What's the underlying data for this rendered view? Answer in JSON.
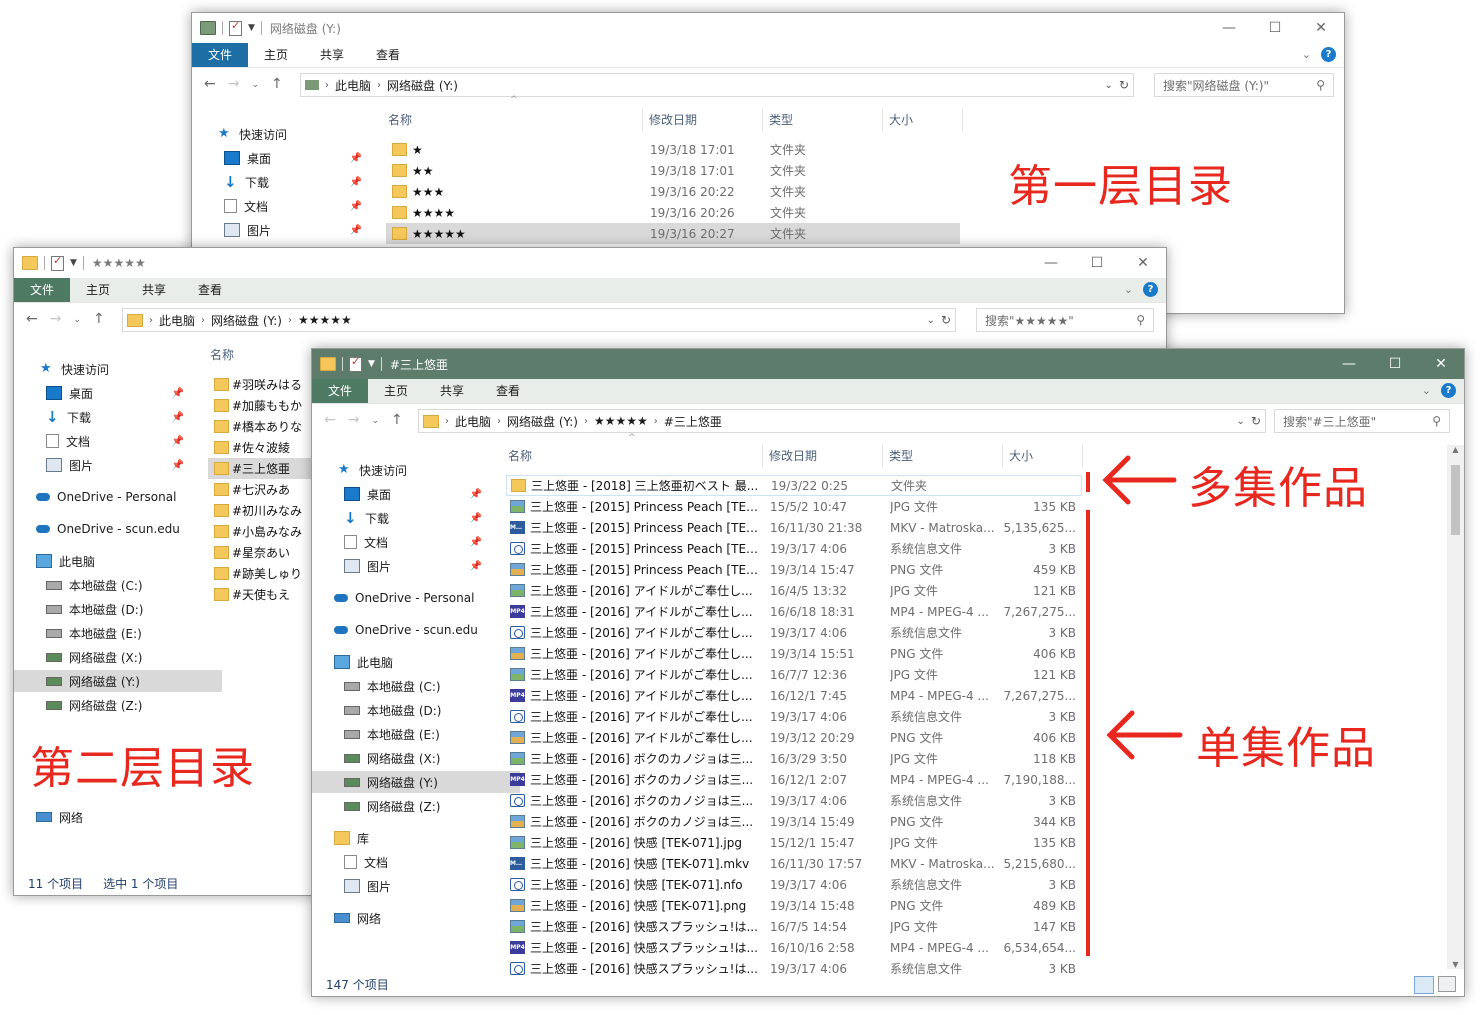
{
  "win1": {
    "title": "网络磁盘 (Y:)",
    "tabs": [
      "文件",
      "主页",
      "共享",
      "查看"
    ],
    "breadcrumbs": [
      "此电脑",
      "网络磁盘 (Y:)"
    ],
    "search_placeholder": "搜索\"网络磁盘 (Y:)\"",
    "sidebar": [
      {
        "icon": "star-icon",
        "label": "快速访问"
      },
      {
        "icon": "desktop-icon",
        "label": "桌面",
        "pinned": true
      },
      {
        "icon": "download-icon",
        "label": "下载",
        "pinned": true
      },
      {
        "icon": "document-icon",
        "label": "文档",
        "pinned": true
      },
      {
        "icon": "pictures-icon",
        "label": "图片",
        "pinned": true
      }
    ],
    "columns": {
      "name": "名称",
      "date": "修改日期",
      "type": "类型",
      "size": "大小"
    },
    "rows": [
      {
        "name": "★",
        "date": "19/3/18 17:01",
        "type": "文件夹"
      },
      {
        "name": "★★",
        "date": "19/3/18 17:01",
        "type": "文件夹"
      },
      {
        "name": "★★★",
        "date": "19/3/16 20:22",
        "type": "文件夹"
      },
      {
        "name": "★★★★",
        "date": "19/3/16 20:26",
        "type": "文件夹"
      },
      {
        "name": "★★★★★",
        "date": "19/3/16 20:27",
        "type": "文件夹",
        "selected": true
      }
    ]
  },
  "win2": {
    "title": "★★★★★",
    "tabs": [
      "文件",
      "主页",
      "共享",
      "查看"
    ],
    "breadcrumbs": [
      "此电脑",
      "网络磁盘 (Y:)",
      "★★★★★"
    ],
    "search_placeholder": "搜索\"★★★★★\"",
    "sidebar": [
      {
        "icon": "star-icon",
        "label": "快速访问"
      },
      {
        "icon": "desktop-icon",
        "label": "桌面",
        "pinned": true
      },
      {
        "icon": "download-icon",
        "label": "下载",
        "pinned": true
      },
      {
        "icon": "document-icon",
        "label": "文档",
        "pinned": true
      },
      {
        "icon": "pictures-icon",
        "label": "图片",
        "pinned": true
      },
      {
        "icon": "onedrive-icon",
        "label": "OneDrive - Personal"
      },
      {
        "icon": "onedrive-icon",
        "label": "OneDrive - scun.edu"
      },
      {
        "icon": "this-pc-icon",
        "label": "此电脑"
      },
      {
        "icon": "drive-icon",
        "label": "本地磁盘 (C:)"
      },
      {
        "icon": "drive-icon",
        "label": "本地磁盘 (D:)"
      },
      {
        "icon": "drive-icon",
        "label": "本地磁盘 (E:)"
      },
      {
        "icon": "network-drive-icon",
        "label": "网络磁盘 (X:)"
      },
      {
        "icon": "network-drive-icon",
        "label": "网络磁盘 (Y:)",
        "selected": true
      },
      {
        "icon": "network-drive-icon",
        "label": "网络磁盘 (Z:)"
      },
      {
        "icon": "network-icon",
        "label": "网络"
      }
    ],
    "name_header": "名称",
    "folders": [
      "#羽咲みはる",
      "#加藤ももか",
      "#橋本ありな",
      "#佐々波綾",
      "#三上悠亜",
      "#七沢みあ",
      "#初川みなみ",
      "#小島みなみ",
      "#星奈あい",
      "#跡美しゅり",
      "#天使もえ"
    ],
    "status": {
      "count": "11 个项目",
      "selected": "选中 1 个项目"
    }
  },
  "win3": {
    "title": "#三上悠亜",
    "tabs": [
      "文件",
      "主页",
      "共享",
      "查看"
    ],
    "breadcrumbs": [
      "此电脑",
      "网络磁盘 (Y:)",
      "★★★★★",
      "#三上悠亜"
    ],
    "search_placeholder": "搜索\"#三上悠亜\"",
    "sidebar": [
      {
        "icon": "star-icon",
        "label": "快速访问"
      },
      {
        "icon": "desktop-icon",
        "label": "桌面",
        "pinned": true
      },
      {
        "icon": "download-icon",
        "label": "下载",
        "pinned": true
      },
      {
        "icon": "document-icon",
        "label": "文档",
        "pinned": true
      },
      {
        "icon": "pictures-icon",
        "label": "图片",
        "pinned": true
      },
      {
        "icon": "onedrive-icon",
        "label": "OneDrive - Personal"
      },
      {
        "icon": "onedrive-icon",
        "label": "OneDrive - scun.edu"
      },
      {
        "icon": "this-pc-icon",
        "label": "此电脑"
      },
      {
        "icon": "drive-icon",
        "label": "本地磁盘 (C:)"
      },
      {
        "icon": "drive-icon",
        "label": "本地磁盘 (D:)"
      },
      {
        "icon": "drive-icon",
        "label": "本地磁盘 (E:)"
      },
      {
        "icon": "network-drive-icon",
        "label": "网络磁盘 (X:)"
      },
      {
        "icon": "network-drive-icon",
        "label": "网络磁盘 (Y:)",
        "selected": true
      },
      {
        "icon": "network-drive-icon",
        "label": "网络磁盘 (Z:)"
      },
      {
        "icon": "library-icon",
        "label": "库"
      },
      {
        "icon": "document-icon",
        "label": "文档"
      },
      {
        "icon": "pictures-icon",
        "label": "图片"
      },
      {
        "icon": "network-icon",
        "label": "网络"
      }
    ],
    "columns": {
      "name": "名称",
      "date": "修改日期",
      "type": "类型",
      "size": "大小"
    },
    "rows": [
      {
        "kind": "folder",
        "name": "三上悠亜 - [2018] 三上悠亜初ベスト 最...",
        "date": "19/3/22 0:25",
        "type": "文件夹",
        "size": ""
      },
      {
        "kind": "jpg",
        "name": "三上悠亜 - [2015] Princess Peach [TEK...",
        "date": "15/5/2 10:47",
        "type": "JPG 文件",
        "size": "135 KB"
      },
      {
        "kind": "mkv",
        "name": "三上悠亜 - [2015] Princess Peach [TEK...",
        "date": "16/11/30 21:38",
        "type": "MKV - Matroska...",
        "size": "5,135,625..."
      },
      {
        "kind": "nfo",
        "name": "三上悠亜 - [2015] Princess Peach [TEK...",
        "date": "19/3/17 4:06",
        "type": "系统信息文件",
        "size": "3 KB"
      },
      {
        "kind": "png",
        "name": "三上悠亜 - [2015] Princess Peach [TEK...",
        "date": "19/3/14 15:47",
        "type": "PNG 文件",
        "size": "459 KB"
      },
      {
        "kind": "jpg",
        "name": "三上悠亜 - [2016] アイドルがご奉仕し...",
        "date": "16/4/5 13:32",
        "type": "JPG 文件",
        "size": "121 KB"
      },
      {
        "kind": "mp4",
        "name": "三上悠亜 - [2016] アイドルがご奉仕し...",
        "date": "16/6/18 18:31",
        "type": "MP4 - MPEG-4 ...",
        "size": "7,267,275..."
      },
      {
        "kind": "nfo",
        "name": "三上悠亜 - [2016] アイドルがご奉仕し...",
        "date": "19/3/17 4:06",
        "type": "系统信息文件",
        "size": "3 KB"
      },
      {
        "kind": "png",
        "name": "三上悠亜 - [2016] アイドルがご奉仕し...",
        "date": "19/3/14 15:51",
        "type": "PNG 文件",
        "size": "406 KB"
      },
      {
        "kind": "jpg",
        "name": "三上悠亜 - [2016] アイドルがご奉仕し...",
        "date": "16/7/7 12:36",
        "type": "JPG 文件",
        "size": "121 KB"
      },
      {
        "kind": "mp4",
        "name": "三上悠亜 - [2016] アイドルがご奉仕し...",
        "date": "16/12/1 7:45",
        "type": "MP4 - MPEG-4 ...",
        "size": "7,267,275..."
      },
      {
        "kind": "nfo",
        "name": "三上悠亜 - [2016] アイドルがご奉仕し...",
        "date": "19/3/17 4:06",
        "type": "系统信息文件",
        "size": "3 KB"
      },
      {
        "kind": "png",
        "name": "三上悠亜 - [2016] アイドルがご奉仕し...",
        "date": "19/3/12 20:29",
        "type": "PNG 文件",
        "size": "406 KB"
      },
      {
        "kind": "jpg",
        "name": "三上悠亜 - [2016] ボクのカノジョは三...",
        "date": "16/3/29 3:50",
        "type": "JPG 文件",
        "size": "118 KB"
      },
      {
        "kind": "mp4",
        "name": "三上悠亜 - [2016] ボクのカノジョは三...",
        "date": "16/12/1 2:07",
        "type": "MP4 - MPEG-4 ...",
        "size": "7,190,188..."
      },
      {
        "kind": "nfo",
        "name": "三上悠亜 - [2016] ボクのカノジョは三...",
        "date": "19/3/17 4:06",
        "type": "系统信息文件",
        "size": "3 KB"
      },
      {
        "kind": "png",
        "name": "三上悠亜 - [2016] ボクのカノジョは三...",
        "date": "19/3/14 15:49",
        "type": "PNG 文件",
        "size": "344 KB"
      },
      {
        "kind": "jpg",
        "name": "三上悠亜 - [2016] 快感 [TEK-071].jpg",
        "date": "15/12/1 15:47",
        "type": "JPG 文件",
        "size": "135 KB"
      },
      {
        "kind": "mkv",
        "name": "三上悠亜 - [2016] 快感 [TEK-071].mkv",
        "date": "16/11/30 17:57",
        "type": "MKV - Matroska...",
        "size": "5,215,680..."
      },
      {
        "kind": "nfo",
        "name": "三上悠亜 - [2016] 快感 [TEK-071].nfo",
        "date": "19/3/17 4:06",
        "type": "系统信息文件",
        "size": "3 KB"
      },
      {
        "kind": "png",
        "name": "三上悠亜 - [2016] 快感 [TEK-071].png",
        "date": "19/3/14 15:48",
        "type": "PNG 文件",
        "size": "489 KB"
      },
      {
        "kind": "jpg",
        "name": "三上悠亜 - [2016] 快感スプラッシュ!は...",
        "date": "16/7/5 14:54",
        "type": "JPG 文件",
        "size": "147 KB"
      },
      {
        "kind": "mp4",
        "name": "三上悠亜 - [2016] 快感スプラッシュ!は...",
        "date": "16/10/16 2:58",
        "type": "MP4 - MPEG-4 ...",
        "size": "6,534,654..."
      },
      {
        "kind": "nfo",
        "name": "三上悠亜 - [2016] 快感スプラッシュ!は...",
        "date": "19/3/17 4:06",
        "type": "系统信息文件",
        "size": "3 KB"
      }
    ],
    "status": {
      "count": "147 个项目"
    }
  },
  "annotations": {
    "level1": "第一层目录",
    "level2": "第二层目录",
    "multi": "多集作品",
    "single": "单集作品"
  },
  "colors": {
    "accent": "#1c6ea4",
    "win3_titlebar": "#5d7c6c",
    "annotation": "#e8281f"
  }
}
